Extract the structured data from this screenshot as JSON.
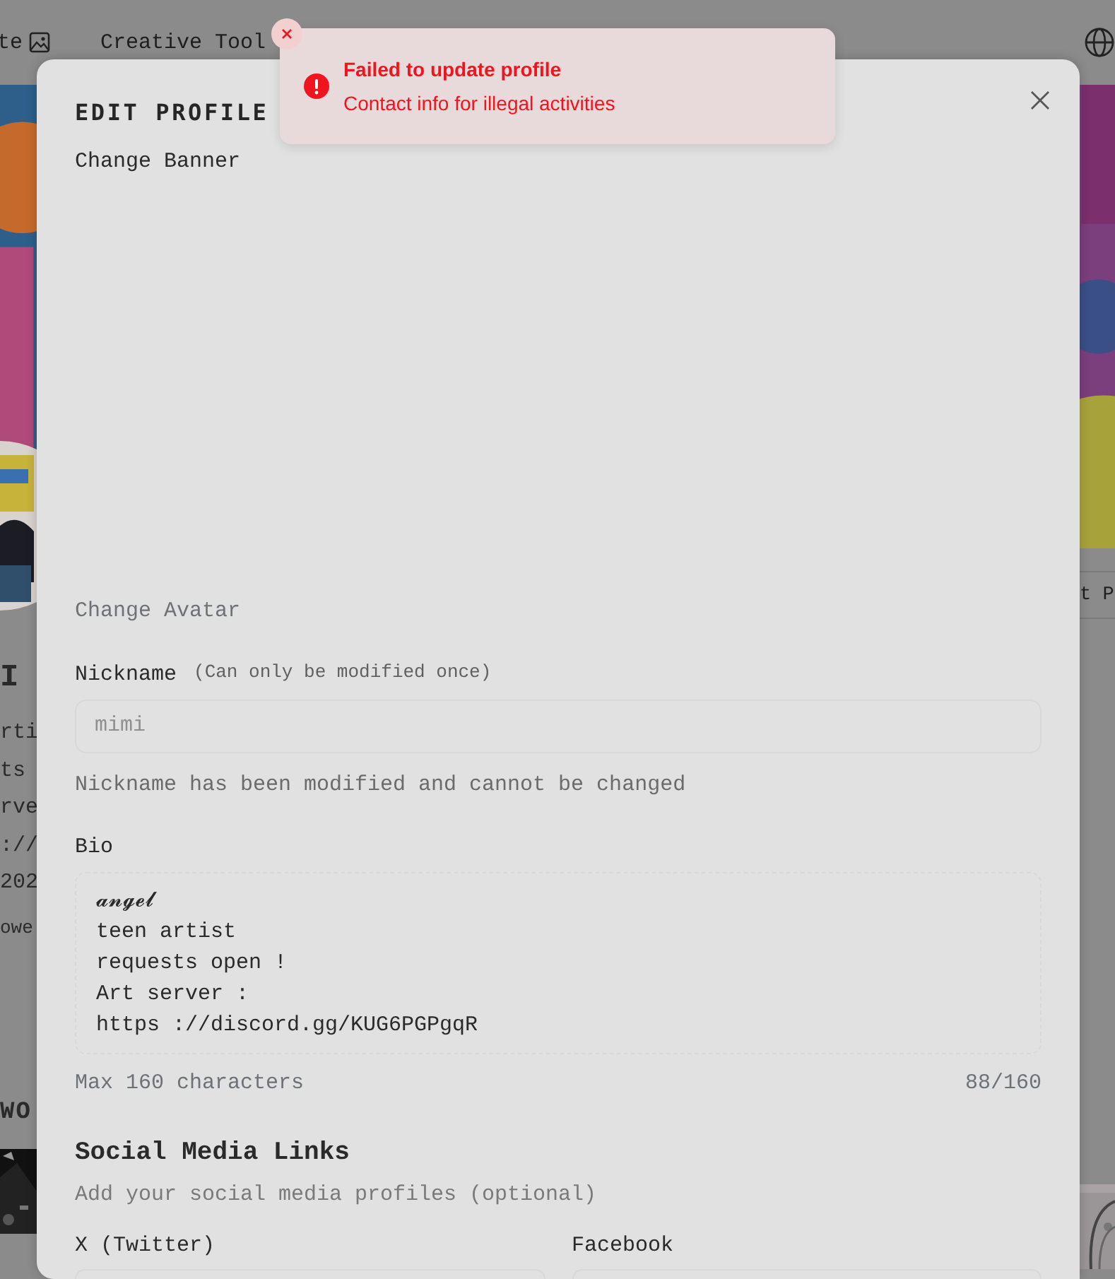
{
  "background_page": {
    "nav_items": [
      "te",
      "Creative Tool"
    ],
    "left_fragments": [
      {
        "kind": "name",
        "text": "I"
      },
      {
        "kind": "text",
        "text": "rti"
      },
      {
        "kind": "text",
        "text": "ts"
      },
      {
        "kind": "text",
        "text": "rve"
      },
      {
        "kind": "text",
        "text": "://"
      },
      {
        "kind": "text",
        "text": "202"
      },
      {
        "kind": "small",
        "text": "owe"
      },
      {
        "kind": "heading",
        "text": "WO"
      }
    ],
    "right_button": "t P"
  },
  "modal": {
    "title": "EDIT PROFILE",
    "change_banner": "Change Banner",
    "change_avatar": "Change Avatar",
    "nickname": {
      "label": "Nickname",
      "note": "(Can only be modified once)",
      "value": "mimi",
      "disabled": true,
      "helper": "Nickname has been modified and cannot be changed"
    },
    "bio": {
      "label": "Bio",
      "value": "𝓪𝓷𝓰𝓮𝓵\nteen artist\nrequests open !\nArt server :\nhttps ://discord.gg/KUG6PGPgqR",
      "hint": "Max 160 characters",
      "count": "88/160"
    },
    "social": {
      "title": "Social Media Links",
      "subtitle": "Add your social media profiles (optional)",
      "fields": [
        {
          "label": "X (Twitter)"
        },
        {
          "label": "Facebook"
        }
      ]
    }
  },
  "toast": {
    "title": "Failed to update profile",
    "message": "Contact info for illegal activities"
  }
}
